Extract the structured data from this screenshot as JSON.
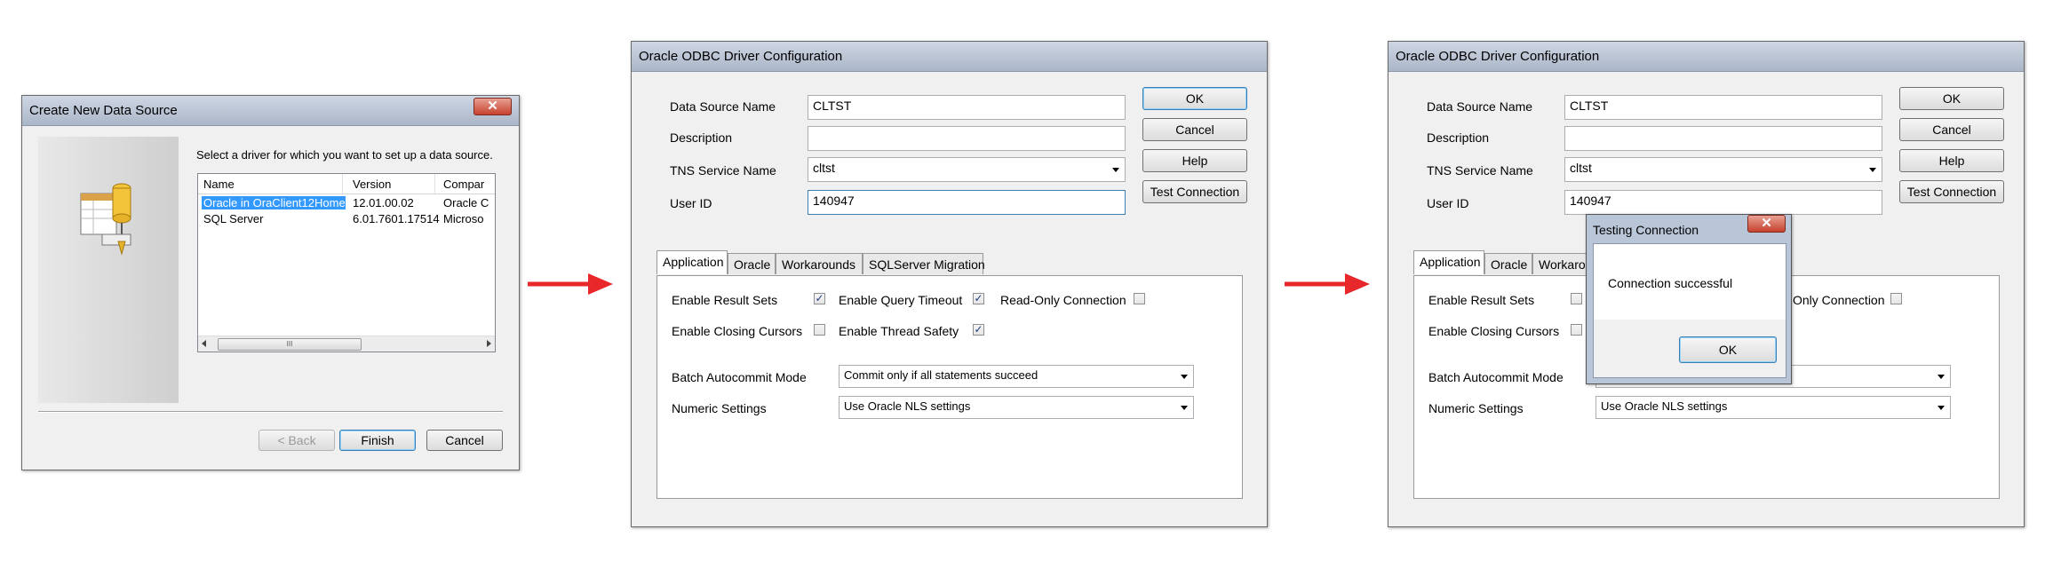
{
  "create_dialog": {
    "title": "Create New Data Source",
    "close_glyph": "✕",
    "instruction": "Select a driver for which you want to set up a data source.",
    "columns": [
      "Name",
      "Version",
      "Compar"
    ],
    "rows": [
      {
        "name": "Oracle in OraClient12Home1",
        "version": "12.01.00.02",
        "company": "Oracle C"
      },
      {
        "name": "SQL Server",
        "version": "6.01.7601.17514",
        "company": "Microso"
      }
    ],
    "scroll_thumb_glyph": "III",
    "back_label": "< Back",
    "finish_label": "Finish",
    "cancel_label": "Cancel"
  },
  "odbc_config_1": {
    "title": "Oracle ODBC Driver Configuration",
    "fields": {
      "dsn_label": "Data Source Name",
      "dsn_value": "CLTST",
      "description_label": "Description",
      "description_value": "",
      "tns_label": "TNS Service Name",
      "tns_value": "cltst",
      "userid_label": "User ID",
      "userid_value": "140947"
    },
    "buttons": {
      "ok": "OK",
      "cancel": "Cancel",
      "help": "Help",
      "test": "Test Connection"
    },
    "tabs": [
      "Application",
      "Oracle",
      "Workarounds",
      "SQLServer Migration"
    ],
    "options": {
      "enable_result_sets": "Enable Result Sets",
      "enable_query_timeout": "Enable Query Timeout",
      "read_only_connection": "Read-Only Connection",
      "enable_closing_cursors": "Enable Closing Cursors",
      "enable_thread_safety": "Enable Thread Safety",
      "batch_label": "Batch Autocommit Mode",
      "batch_value": "Commit only if all statements succeed",
      "numeric_label": "Numeric Settings",
      "numeric_value": "Use Oracle NLS settings"
    },
    "checkbox_checked_glyph": "✓"
  },
  "odbc_config_2": {
    "title": "Oracle ODBC Driver Configuration",
    "fields": {
      "dsn_label": "Data Source Name",
      "dsn_value": "CLTST",
      "description_label": "Description",
      "tns_label": "TNS Service Name",
      "tns_value": "cltst",
      "userid_label": "User ID",
      "userid_value": "140947"
    },
    "buttons": {
      "ok": "OK",
      "cancel": "Cancel",
      "help": "Help",
      "test": "Test Connection"
    },
    "tabs": [
      "Application",
      "Oracle",
      "Workaro"
    ],
    "options": {
      "enable_result_sets": "Enable Result Sets",
      "read_only_partial": "Only Connection",
      "enable_closing_cursors": "Enable Closing Cursors",
      "batch_label": "Batch Autocommit Mode",
      "batch_value_partial": "d",
      "numeric_label": "Numeric Settings",
      "numeric_value": "Use Oracle NLS settings"
    }
  },
  "testing_popup": {
    "title": "Testing Connection",
    "message": "Connection successful",
    "ok_label": "OK",
    "close_glyph": "✕"
  },
  "colors": {
    "arrow": "#e8272b",
    "selection": "#3399ff"
  }
}
